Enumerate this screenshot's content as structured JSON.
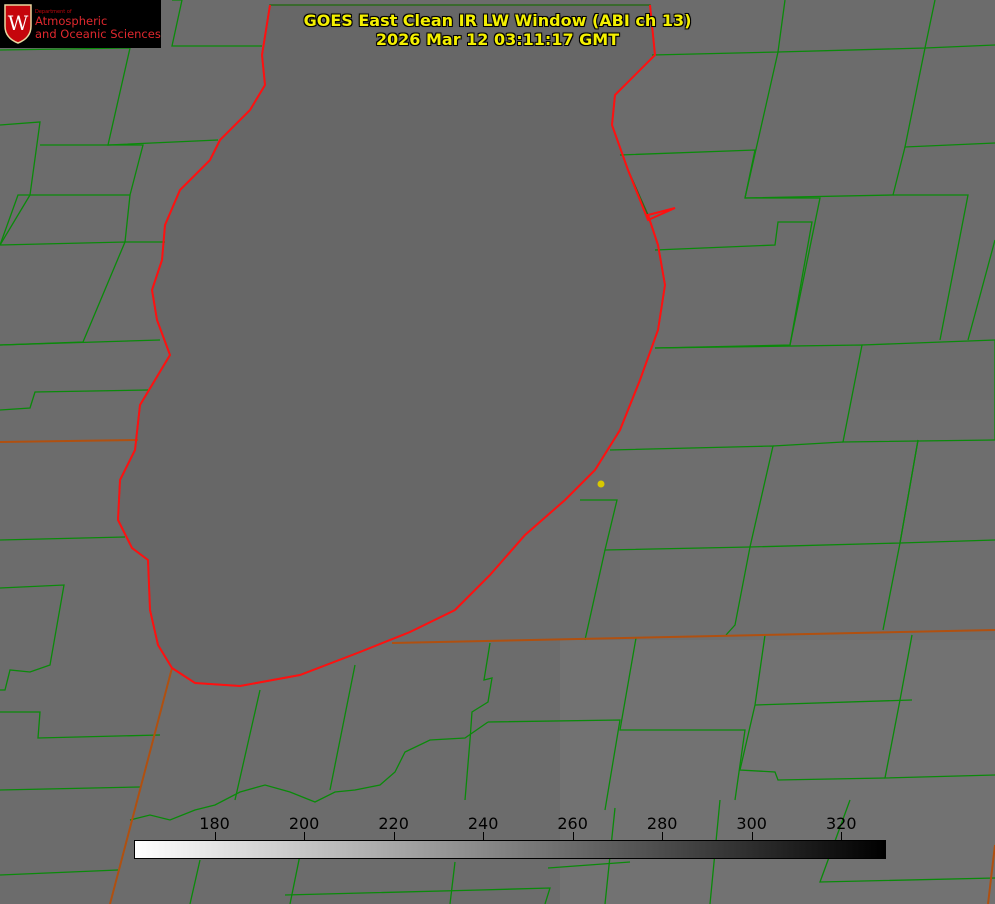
{
  "map": {
    "title_line1": "GOES East Clean IR LW Window (ABI ch 13)",
    "title_line2": "2026 Mar 12 03:11:17 GMT",
    "background_color": "#6e6e6e",
    "lake_color": "#676767",
    "county_line_color": "#0a8a0a",
    "state_line_color": "#b05010",
    "coastline_color": "#ff1010",
    "marker_color": "#d8c800"
  },
  "logo": {
    "department": "Department of",
    "line1": "Atmospheric",
    "line2": "and Oceanic Sciences",
    "seal_letter": "W"
  },
  "colorbar": {
    "ticks": [
      "180",
      "200",
      "220",
      "240",
      "260",
      "280",
      "300",
      "320"
    ],
    "vmin": 162,
    "vmax": 330,
    "gradient_start": "#ffffff",
    "gradient_end": "#000000"
  }
}
